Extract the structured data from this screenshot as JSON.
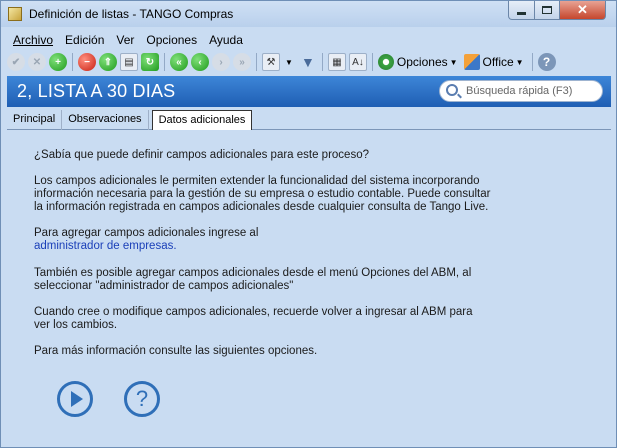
{
  "window": {
    "title": "Definición de listas - TANGO Compras",
    "controls": {
      "minimize": "minimize",
      "maximize": "maximize",
      "close": "✕"
    }
  },
  "menu": [
    "Archivo",
    "Edición",
    "Ver",
    "Opciones",
    "Ayuda"
  ],
  "toolbar": {
    "opciones_label": "Opciones",
    "office_label": "Office",
    "help_label": "?",
    "icons": [
      "check-icon",
      "cancel-icon",
      "add-icon",
      "delete-icon",
      "copy-icon",
      "print-icon",
      "refresh-icon",
      "first-icon",
      "prev-icon",
      "next-icon",
      "last-icon",
      "tools-icon",
      "filter-icon",
      "grid-icon",
      "sort-icon",
      "options-icon",
      "office-icon",
      "help-icon"
    ]
  },
  "header": {
    "record_title": "2, LISTA A 30 DIAS",
    "search_placeholder": "Búsqueda rápida (F3)"
  },
  "tabs": [
    "Principal",
    "Observaciones",
    "Datos adicionales"
  ],
  "active_tab": "Datos adicionales",
  "content": {
    "p1": "¿Sabía que puede definir campos adicionales para este proceso?",
    "p2_l1": "Los campos adicionales le permiten extender la funcionalidad del sistema incorporando",
    "p2_l2": "información necesaria para la gestión de su empresa o estudio contable. Puede consultar",
    "p2_l3": "la información registrada en campos adicionales desde cualquier consulta de Tango Live.",
    "p3_l1": "Para agregar campos adicionales ingrese al",
    "p3_link": "administrador de empresas.",
    "p4_l1": "También es posible agregar campos adicionales desde el menú Opciones del ABM, al",
    "p4_l2": "seleccionar \"administrador de campos adicionales\"",
    "p5_l1": "Cuando cree o modifique campos adicionales, recuerde volver a ingresar al ABM para",
    "p5_l2": "ver los cambios.",
    "p6": "Para más información consulte las siguientes opciones.",
    "help_button": "?"
  },
  "colors": {
    "header_blue": "#1f5eb3",
    "link_blue": "#1a3fb8",
    "panel_bg": "#c9dcf2"
  }
}
